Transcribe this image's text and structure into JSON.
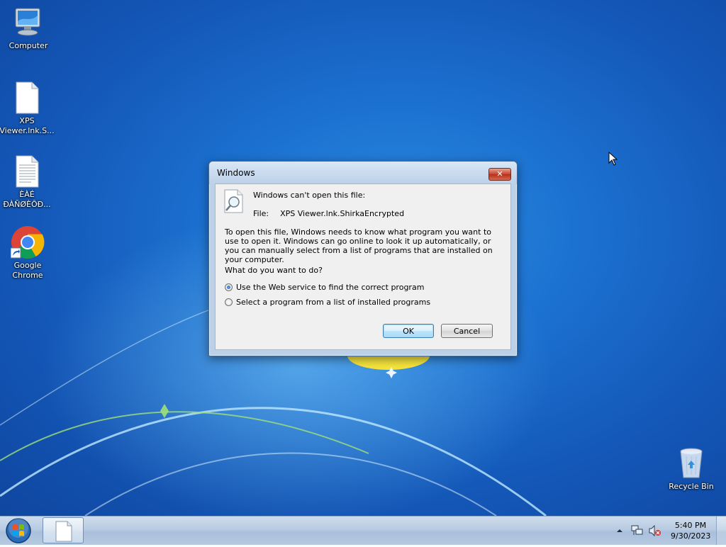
{
  "desktop": {
    "icons": [
      {
        "label": "Computer",
        "icon": "computer-icon"
      },
      {
        "label": "XPS Viewer.lnk.S...",
        "icon": "blank-file-icon"
      },
      {
        "label": "ÈÀÉ ÐÀÑØÈÔÐ...",
        "icon": "text-file-icon"
      },
      {
        "label": "Google Chrome",
        "icon": "chrome-icon"
      },
      {
        "label": "Recycle Bin",
        "icon": "recycle-bin-icon"
      }
    ]
  },
  "dialog": {
    "title": "Windows",
    "close_label": "✕",
    "message": "Windows can't open this file:",
    "file_label": "File:",
    "file_name": "XPS Viewer.lnk.ShirkaEncrypted",
    "paragraph": "To open this file, Windows needs to know what program you want to use to open it. Windows can go online to look it up automatically, or you can manually select from a list of programs that are installed on your computer.",
    "question": "What do you want to do?",
    "options": [
      {
        "label": "Use the Web service to find the correct program",
        "selected": true
      },
      {
        "label": "Select a program from a list of installed programs",
        "selected": false
      }
    ],
    "ok_label": "OK",
    "cancel_label": "Cancel"
  },
  "taskbar": {
    "time": "5:40 PM",
    "date": "9/30/2023",
    "tray_icons": [
      "show-hidden-icons-arrow",
      "network-icon",
      "volume-muted-icon"
    ]
  },
  "colors": {
    "desktop_blue": "#1b6fcf",
    "dialog_frame": "#bcd0e8",
    "close_red": "#c7432b"
  }
}
